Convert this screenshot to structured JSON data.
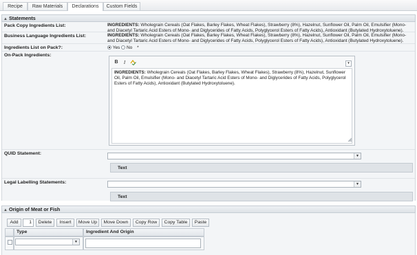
{
  "tabs": [
    "Recipe",
    "Raw Materials",
    "Declarations",
    "Custom Fields"
  ],
  "statements": {
    "header": "Statements",
    "pack_copy_label": "Pack Copy Ingredients List:",
    "pack_copy_bold": "INGREDIENTS:",
    "pack_copy_text": " Wholegrain Cereals (Oat Flakes, Barley Flakes, Wheat Flakes), Strawberry (8%), Hazelnut, Sunflower Oil, Palm Oil, Emulsifier (Mono- and Diacetyl Tartaric Acid Esters of Mono- and Diglycerides of Fatty Acids, Polyglycerol Esters of Fatty Acids), Antioxidant (Butylated Hydroxytoluene).",
    "business_label": "Business Language Ingredients List:",
    "business_bold": "INGREDIENTS:",
    "business_text": " Wholegrain Cereals (Oat Flakes, Barley Flakes, Wheat Flakes), Strawberry (8%), Hazelnut, Sunflower Oil, Palm Oil, Emulsifier (Mono- and Diacetyl Tartaric Acid Esters of Mono- and Diglycerides of Fatty Acids, Polyglycerol Esters of Fatty Acids), Antioxidant (Butylated Hydroxytoluene).",
    "on_pack_q_label": "Ingredients List on Pack?:",
    "yes_label": "Yes",
    "no_label": "No",
    "required_mark": "*",
    "selected": "Yes",
    "on_pack_label": "On-Pack Ingredients:",
    "editor_bold_btn": "B",
    "editor_italic_btn": "I",
    "editor_bold": "INGREDIENTS:",
    "editor_text": " Wholegrain Cereals (Oat Flakes, Barley Flakes, Wheat Flakes), Strawberry (8%), Hazelnut, Sunflower Oil, Palm Oil, Emulsifier (Mono- and Diacetyl Tartaric Acid Esters of Mono- and Diglycerides of Fatty Acids, Polyglycerol Esters of Fatty Acids), Antioxidant (Butylated Hydroxytoluene).",
    "quid_label": "QUID Statement:",
    "quid_value": "",
    "quid_text_header": "Text",
    "legal_label": "Legal Labelling Statements:",
    "legal_value": "",
    "legal_text_header": "Text"
  },
  "origin": {
    "header": "Origin of Meat or Fish",
    "add_label": "Add",
    "count_value": "1",
    "buttons": [
      "Delete",
      "Insert",
      "Move Up",
      "Move Down",
      "Copy Row",
      "Copy Table",
      "Paste"
    ],
    "columns": [
      "Type",
      "Ingredient And Origin"
    ],
    "row_type_value": "",
    "row_origin_value": ""
  },
  "colors": {
    "accent": "#2b5a8a",
    "panel_bg": "#f3f5f7",
    "header_bg": "#e3e7eb"
  },
  "icons": [
    "collapse-chevron-icon",
    "bold-icon",
    "italic-icon",
    "spellcheck-icon",
    "dropdown-arrow-icon",
    "resize-grip-icon"
  ]
}
